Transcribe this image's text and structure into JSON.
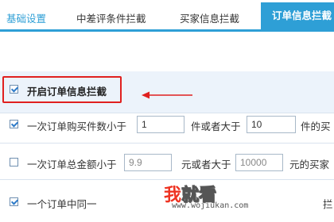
{
  "tabs": [
    {
      "label": "基础设置"
    },
    {
      "label": "中差评条件拦截"
    },
    {
      "label": "买家信息拦截"
    },
    {
      "label": "订单信息拦截"
    }
  ],
  "rules": {
    "enable": {
      "label": "开启订单信息拦截",
      "checked": true
    },
    "quantity": {
      "checked": true,
      "prefix": "一次订单购买件数小于",
      "min_value": "1",
      "middle": "件或者大于",
      "max_value": "10",
      "suffix": "件的买"
    },
    "amount": {
      "checked": false,
      "prefix": "一次订单总金额小于",
      "min_value": "9.9",
      "middle": "元或者大于",
      "max_value": "10000",
      "suffix": "元的买家"
    },
    "same_item": {
      "checked": true,
      "prefix": "一个订单中同一",
      "trailing": "拦"
    }
  },
  "watermark": {
    "char1": "我",
    "chars_rest": "就看",
    "url": "www.wojiukan.com"
  },
  "colors": {
    "accent": "#2e9fd6",
    "highlight_row": "#ecf3fb",
    "annotation_red": "#e0201f"
  }
}
